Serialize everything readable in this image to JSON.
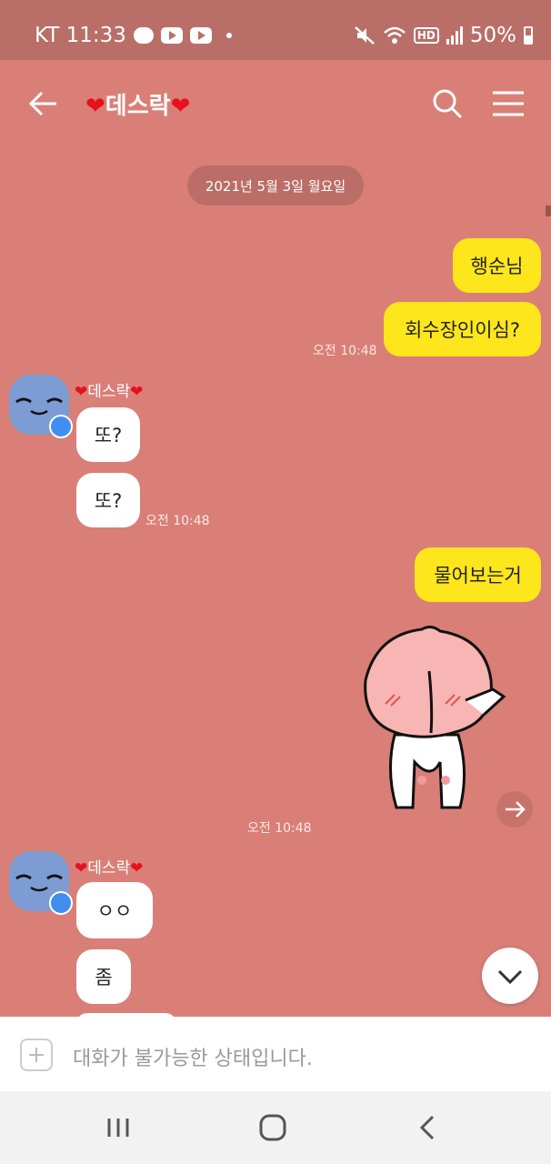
{
  "status": {
    "carrier_time": "KT 11:33",
    "battery": "50%",
    "hd": "HD"
  },
  "header": {
    "title_name": "데스락",
    "heart": "❤"
  },
  "date_divider": "2021년 5월 3일 월요일",
  "messages": {
    "me1": "행순님",
    "me2": "회수장인이심?",
    "me_time1": "오전 10:48",
    "sender1": "데스락",
    "them1": "또?",
    "them2": "또?",
    "them_time1": "오전 10:48",
    "me3": "물어보는거",
    "sticker_time": "오전 10:48",
    "sender2": "데스락",
    "them3": "ㅇㅇ",
    "them4": "좀"
  },
  "input": {
    "placeholder": "대화가 불가능한 상태입니다."
  },
  "colors": {
    "background": "#d97f77",
    "status_bar": "#b96f68",
    "my_bubble": "#fde61c",
    "their_bubble": "#ffffff"
  }
}
